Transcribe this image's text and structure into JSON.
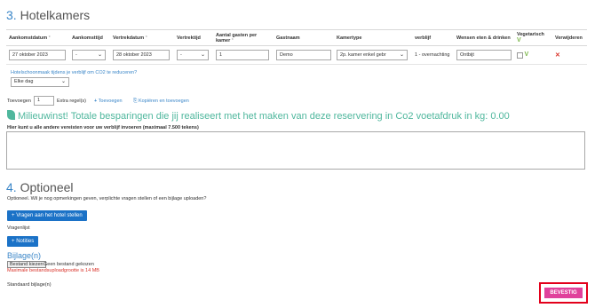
{
  "section3": {
    "number": "3.",
    "title": "Hotelkamers"
  },
  "table": {
    "headers": {
      "arrival_date": "Aankomstdatum",
      "arrival_time": "Aankomsttijd",
      "departure_date": "Vertrekdatum",
      "departure_time": "Vertrektijd",
      "guests": "Aantal gasten per kamer",
      "guest_name": "Gastnaam",
      "room_type": "Kamertype",
      "stay": "verblijf",
      "wishes": "Wensen eten & drinken",
      "vegetarian": "Vegetarisch",
      "delete": "Verwijderen"
    },
    "row": {
      "arrival_date": "27 oktober 2023",
      "arrival_time": "-",
      "departure_date": "28 oktober 2023",
      "departure_time": "-",
      "guests": "1",
      "guest_name": "Demo",
      "room_type": "2p. kamer enkel gebr",
      "stay": "1 - overnachting",
      "wishes": "Ontbijt"
    }
  },
  "co2": {
    "question": "Hotelschoonmaak tijdens je verblijf om CO2 te reduceren?",
    "selected": "Elke dag"
  },
  "add_rows": {
    "prefix": "Toevoegen",
    "count": "1",
    "suffix": "Extra regel(s)",
    "add_link": "Toevoegen",
    "copy_link": "Kopiëren en toevoegen"
  },
  "eco": {
    "text": "Milieuwinst! Totale besparingen die jij realiseert met het maken van deze reservering in Co2 voetafdruk in kg: 0.00"
  },
  "requirements_label": "Hier kunt u alle andere vereisten voor uw verblijf invoeren (maximaal 7.500 tekens)",
  "section4": {
    "number": "4.",
    "title": "Optioneel",
    "intro": "Optioneel. Wil je nog opmerkingen geven, verplichte vragen stellen of een bijlage uploaden?",
    "ask_button": "Vragen aan het hotel stellen",
    "questions_label": "Vragenlijst",
    "notes_button": "Notities",
    "attachments_title": "Bijlage(n)",
    "choose_file": "Bestand kiezen",
    "no_file": "Geen bestand gekozen",
    "max_size": "Maximale bestandsuploadgrootte is 14 MB",
    "default_attachments": "Standaard bijlage(n)"
  },
  "confirm_button": "BEVESTIG",
  "colors": {
    "accent_blue": "#1b72c7",
    "eco_green": "#4fb79d",
    "confirm_pink": "#e0419b",
    "highlight_red": "#e3001b"
  }
}
